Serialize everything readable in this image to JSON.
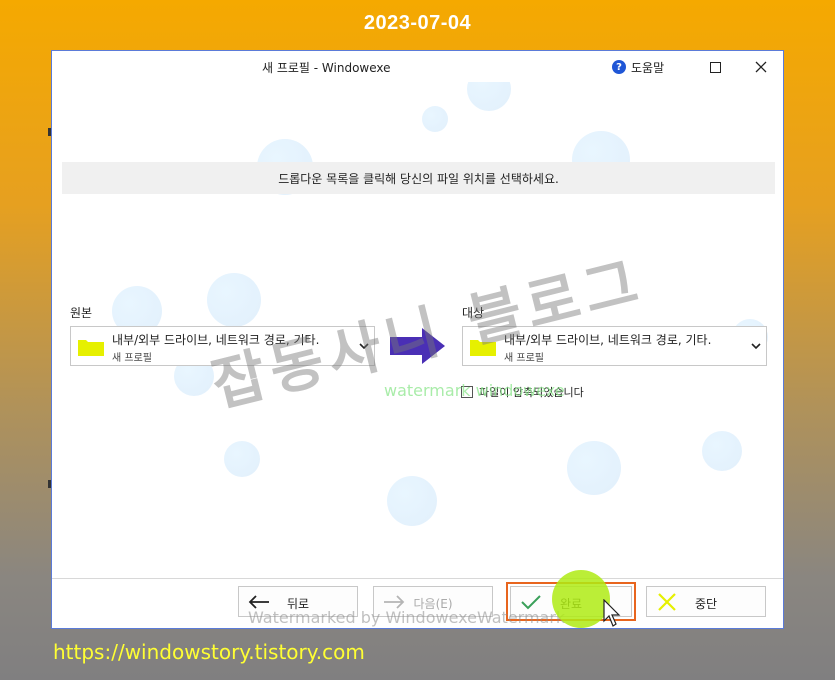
{
  "overlay": {
    "date": "2023-07-04",
    "url": "https://windowstory.tistory.com"
  },
  "window": {
    "title": "새 프로필  - Windowexe",
    "help_label": "도움말",
    "help_icon": "question-circle-icon",
    "controls": [
      "maximize-icon",
      "close-icon"
    ]
  },
  "instruction": "드롭다운 목록을 클릭해 당신의 파일 위치를 선택하세요.",
  "source": {
    "label": "원본",
    "line1": "내부/외부 드라이브, 네트워크 경로, 기타.",
    "line2": "새 프로필",
    "icon": "folder-icon"
  },
  "target": {
    "label": "대상",
    "line1": "내부/외부 드라이브, 네트워크 경로, 기타.",
    "line2": "새 프로필",
    "icon": "folder-icon"
  },
  "compress_checkbox": {
    "label": "파일이 압축되었습니다",
    "checked": false
  },
  "buttons": {
    "back": "뒤로",
    "next": "다음(E)",
    "finish": "완료",
    "cancel": "중단"
  },
  "watermarks": {
    "korean": "잡동사니 블로그",
    "green": "watermark  windowexe",
    "bottom": "Watermarked by WindowexeWatermark"
  },
  "colors": {
    "arrow": "#4a2fb5",
    "folder": "#e6f000",
    "finish_focus": "#e8651e",
    "cursor_halo": "#b4ea14",
    "help_icon": "#1f56d6"
  }
}
